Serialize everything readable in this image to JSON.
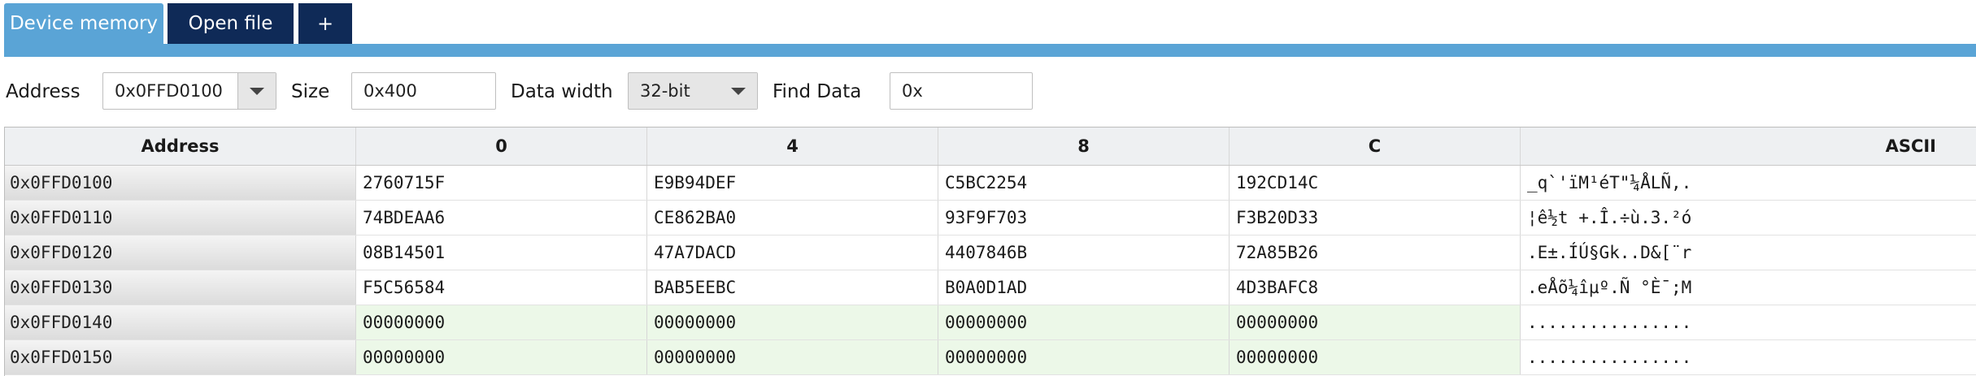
{
  "tabs": [
    {
      "label": "Device memory",
      "active": true
    },
    {
      "label": "Open file",
      "active": false
    },
    {
      "label": "+",
      "active": false
    }
  ],
  "toolbar": {
    "address_label": "Address",
    "address_value": "0x0FFD0100",
    "size_label": "Size",
    "size_value": "0x400",
    "data_width_label": "Data width",
    "data_width_value": "32-bit",
    "find_label": "Find Data",
    "find_value": "0x"
  },
  "grid": {
    "headers": {
      "address": "Address",
      "c0": "0",
      "c4": "4",
      "c8": "8",
      "cc": "C",
      "ascii": "ASCII"
    },
    "rows": [
      {
        "address": "0x0FFD0100",
        "c0": "2760715F",
        "c4": "E9B94DEF",
        "c8": "C5BC2254",
        "cc": "192CD14C",
        "ascii": "_q`'ïM¹éT\"¼ÅLÑ,."
      },
      {
        "address": "0x0FFD0110",
        "c0": "74BDEAA6",
        "c4": "CE862BA0",
        "c8": "93F9F703",
        "cc": "F3B20D33",
        "ascii": "¦ê½t +.Î.÷ù.3.²ó"
      },
      {
        "address": "0x0FFD0120",
        "c0": "08B14501",
        "c4": "47A7DACD",
        "c8": "4407846B",
        "cc": "72A85B26",
        "ascii": ".E±.ÍÚ§Gk..D&[¨r"
      },
      {
        "address": "0x0FFD0130",
        "c0": "F5C56584",
        "c4": "BAB5EEBC",
        "c8": "B0A0D1AD",
        "cc": "4D3BAFC8",
        "ascii": ".eÅõ¼îµº.Ñ °È¯;M"
      },
      {
        "address": "0x0FFD0140",
        "c0": "00000000",
        "c4": "00000000",
        "c8": "00000000",
        "cc": "00000000",
        "ascii": "................"
      },
      {
        "address": "0x0FFD0150",
        "c0": "00000000",
        "c4": "00000000",
        "c8": "00000000",
        "cc": "00000000",
        "ascii": "................"
      }
    ]
  },
  "colors": {
    "tab_active": "#5aa4d6",
    "tab_inactive": "#0f2a57",
    "zero_row_bg": "#ecf8e8"
  }
}
